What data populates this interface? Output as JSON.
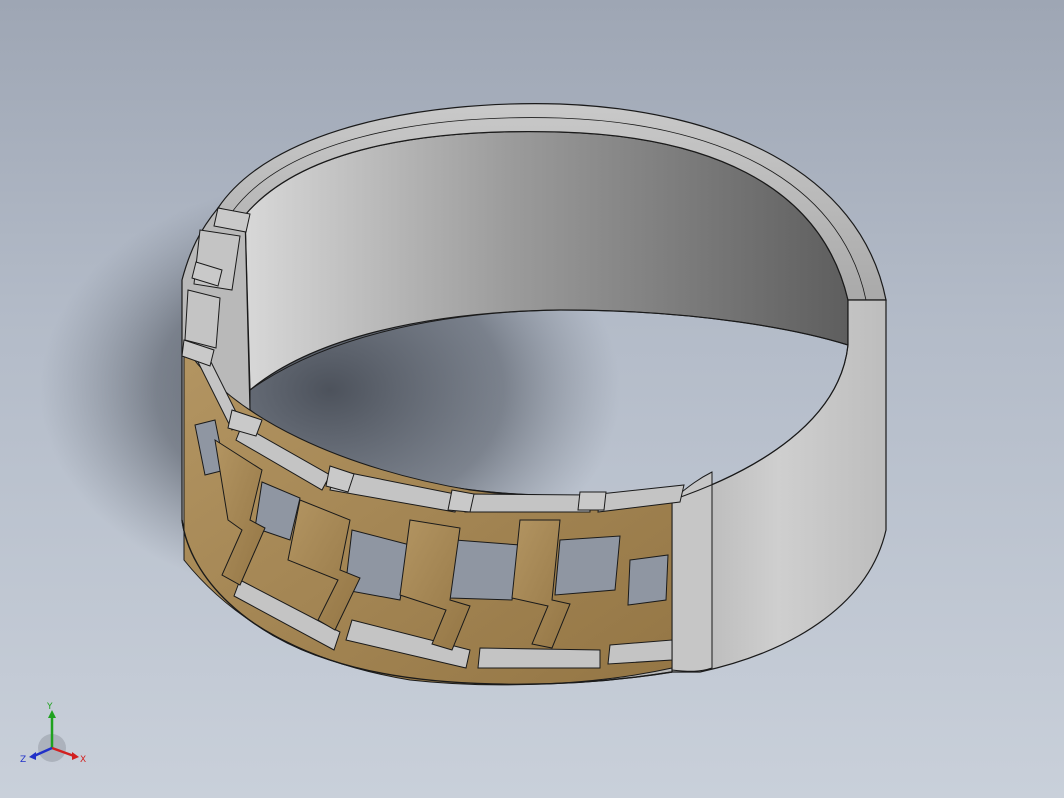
{
  "viewport": {
    "background_top": "#9ea6b4",
    "background_bottom": "#c9d0da"
  },
  "model": {
    "name": "ring-with-greek-key-inlay",
    "metal_color": "#bfc0c2",
    "inlay_color": "#a88a56",
    "edge_color": "#1a1a1a"
  },
  "triad": {
    "x_label": "X",
    "y_label": "Y",
    "z_label": "Z",
    "x_color": "#d22020",
    "y_color": "#1fa11f",
    "z_color": "#2030c8"
  }
}
